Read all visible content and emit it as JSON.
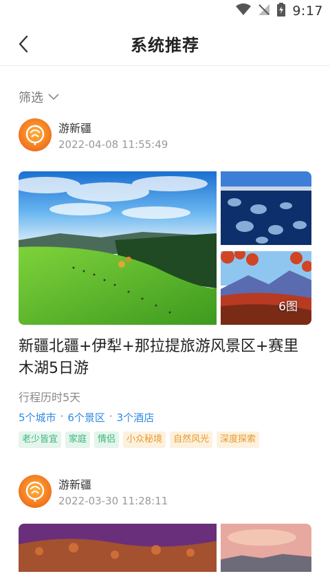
{
  "status_bar": {
    "time": "9:17"
  },
  "header": {
    "title": "系统推荐"
  },
  "filter": {
    "label": "筛选"
  },
  "posts": [
    {
      "author": "游新疆",
      "time": "2022-04-08 11:55:49",
      "photo_count": "6图",
      "title": "新疆北疆+伊犁+那拉提旅游风景区+赛里木湖5日游",
      "duration": "行程历时5天",
      "stats": [
        "5个城市",
        "·",
        "6个景区",
        "·",
        "3个酒店"
      ],
      "tags": [
        {
          "label": "老少皆宜",
          "color": "green"
        },
        {
          "label": "家庭",
          "color": "green"
        },
        {
          "label": "情侣",
          "color": "green"
        },
        {
          "label": "小众秘境",
          "color": "orange"
        },
        {
          "label": "自然风光",
          "color": "orange"
        },
        {
          "label": "深度探索",
          "color": "orange"
        }
      ]
    },
    {
      "author": "游新疆",
      "time": "2022-03-30 11:28:11"
    }
  ],
  "colors": {
    "link_blue": "#2f8ae0",
    "tag_green": "#3bb67a",
    "tag_orange": "#e79a2a",
    "avatar_orange": "#f47b20"
  },
  "icons": {
    "back": "chevron-left-icon",
    "filter": "chevron-down-icon",
    "wifi": "wifi-icon",
    "signal": "no-signal-icon",
    "battery": "battery-charging-icon"
  }
}
